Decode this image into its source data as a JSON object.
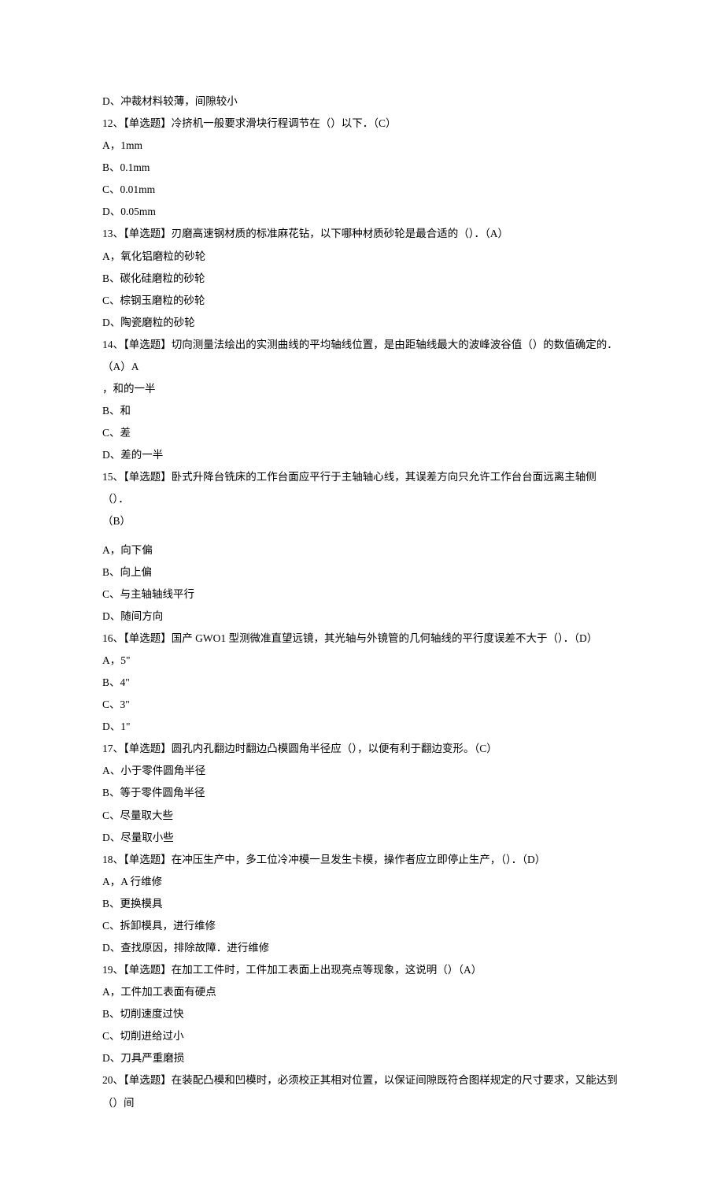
{
  "lines": [
    "D、冲裁材料较薄，间隙较小",
    "12、【单选题】冷挤机一般要求滑块行程调节在（）以下．（C）",
    "A，1mm",
    "B、0.1mm",
    "C、0.01mm",
    "D、0.05mm",
    "13、【单选题】刃磨高速钢材质的标准麻花钻，以下哪种材质砂轮是最合适的（）．（A）",
    "A，氧化铝磨粒的砂轮",
    "B、碳化硅磨粒的砂轮",
    "C、棕钢玉磨粒的砂轮",
    "D、陶瓷磨粒的砂轮",
    "14、【单选题】切向测量法绘出的实测曲线的平均轴线位置，是由距轴线最大的波峰波谷值（）的数值确定的．（A）A",
    "，和的一半",
    "B、和",
    "C、差",
    "D、差的一半",
    "15、【单选题】卧式升降台铣床的工作台面应平行于主轴轴心线，其误差方向只允许工作台台面远离主轴侧（）．",
    "（B）",
    "A，向下偏",
    "B、向上偏",
    "C、与主轴轴线平行",
    "D、随间方向",
    "16、【单选题】国产 GWO1 型测微准直望远镜，其光轴与外镜管的几何轴线的平行度误差不大于（）．（D）",
    "A，5\"",
    "B、4\"",
    "C、3\"",
    "D、1\"",
    "17、【单选题】圆孔内孔翻边时翻边凸模圆角半径应（），以便有利于翻边变形。（C）",
    "A、小于零件圆角半径",
    "B、等于零件圆角半径",
    "C、尽量取大些",
    "D、尽量取小些",
    "18、【单选题】在冲压生产中，多工位冷冲模一旦发生卡模，操作者应立即停止生产，（）．（D）",
    "A，A 行维修",
    "B、更换模具",
    "C、拆卸模具，进行维修",
    "D、查找原因，排除故障．进行维修",
    "19、【单选题】在加工工件时，工件加工表面上出现亮点等现象，这说明（）（A）",
    "A，工件加工表面有硬点",
    "B、切削速度过快",
    "C、切削进给过小",
    "D、刀具严重磨损",
    "20、【单选题】在装配凸模和凹模时，必须校正其相对位置，以保证间隙既符合图样规定的尺寸要求，又能达到（）间"
  ]
}
